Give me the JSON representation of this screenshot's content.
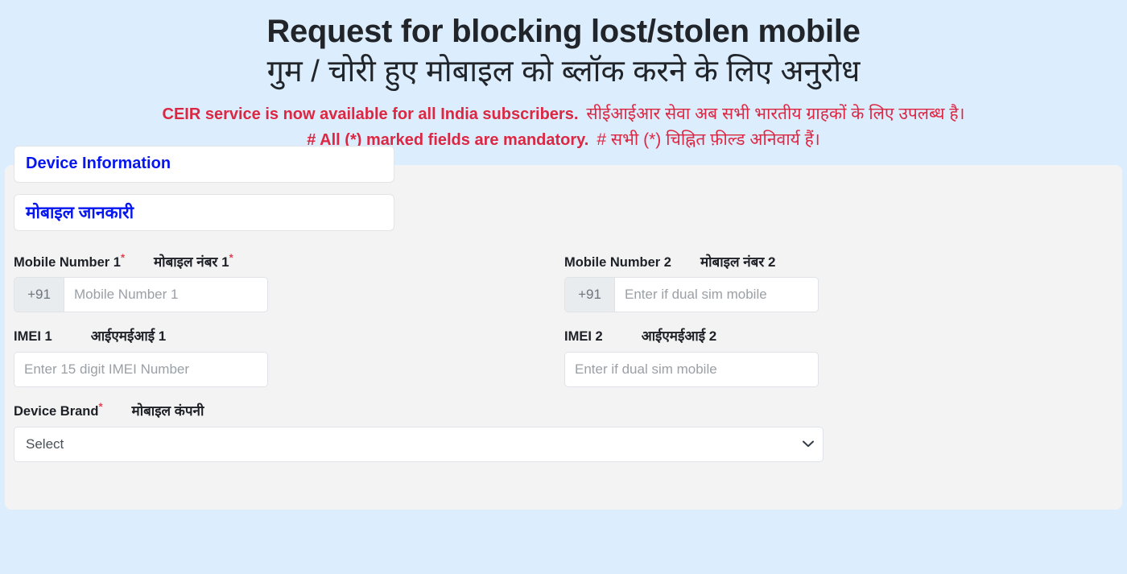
{
  "header": {
    "title_en": "Request for blocking lost/stolen mobile",
    "title_hi": "गुम / चोरी हुए मोबाइल को ब्लॉक करने के लिए अनुरोध",
    "notice_line1_en": "CEIR service is now available for all India subscribers.",
    "notice_line1_hi": "सीईआईआर सेवा अब सभी भारतीय ग्राहकों के लिए उपलब्ध है।",
    "notice_line2_en": "# All (*) marked fields are mandatory.",
    "notice_line2_hi": "# सभी (*) चिह्नित फ़ील्ड अनिवार्य हैं।",
    "notice_color": "#dc2743",
    "title_color": "#212529",
    "page_background": "#dcedfd"
  },
  "section": {
    "heading_en": "Device Information",
    "heading_hi": "मोबाइल जानकारी",
    "heading_color": "#0616f0",
    "panel_background": "#f3f3f3"
  },
  "fields": {
    "mobile1": {
      "label_en": "Mobile Number 1",
      "label_hi": "मोबाइल नंबर 1",
      "required": "*",
      "prefix": "+91",
      "placeholder": "Mobile Number 1",
      "value": ""
    },
    "mobile2": {
      "label_en": "Mobile Number 2",
      "label_hi": "मोबाइल नंबर 2",
      "prefix": "+91",
      "placeholder": "Enter if dual sim mobile",
      "value": ""
    },
    "imei1": {
      "label_en": "IMEI 1",
      "label_hi": "आईएमईआई 1",
      "placeholder": "Enter 15 digit IMEI Number",
      "value": ""
    },
    "imei2": {
      "label_en": "IMEI 2",
      "label_hi": "आईएमईआई 2",
      "placeholder": "Enter if dual sim mobile",
      "value": ""
    },
    "device_brand": {
      "label_en": "Device Brand",
      "label_hi": "मोबाइल कंपनी",
      "required": "*",
      "selected": "Select",
      "icon": "chevron-down-icon"
    }
  }
}
